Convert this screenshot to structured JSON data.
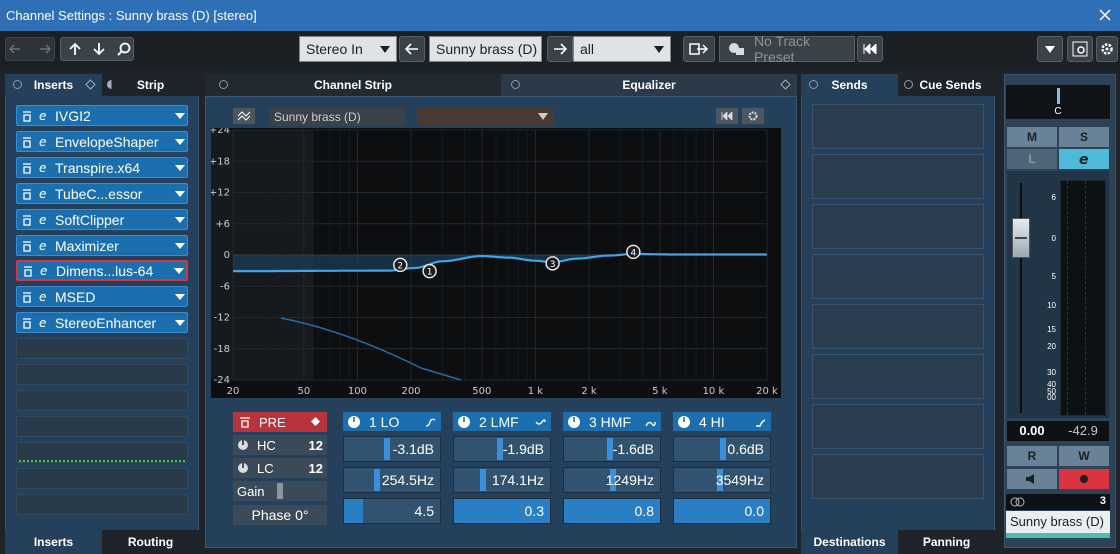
{
  "window": {
    "title": "Channel Settings : Sunny brass (D) [stereo]"
  },
  "toolbar": {
    "input": "Stereo In",
    "track": "Sunny brass (D)",
    "filter": "all",
    "preset_placeholder": "No Track Preset"
  },
  "left": {
    "tab_inserts": "Inserts",
    "tab_strip": "Strip",
    "bottom_inserts": "Inserts",
    "bottom_routing": "Routing",
    "plugins": [
      "IVGI2",
      "EnvelopeShaper",
      "Transpire.x64",
      "TubeC...essor",
      "SoftClipper",
      "Maximizer",
      "Dimens...lus-64",
      "MSED",
      "StereoEnhancer"
    ]
  },
  "center": {
    "tab_channelstrip": "Channel Strip",
    "tab_equalizer": "Equalizer",
    "preset": "Sunny brass (D)",
    "ylabels": [
      "+24",
      "+18",
      "+12",
      "+6",
      "0",
      "-6",
      "-12",
      "-18",
      "-24"
    ],
    "xlabels": [
      "20",
      "50",
      "100",
      "200",
      "500",
      "1 k",
      "2 k",
      "5 k",
      "10 k",
      "20 k"
    ],
    "pre": "PRE",
    "hc": "HC",
    "hc_val": "12",
    "lc": "LC",
    "lc_val": "12",
    "gain": "Gain",
    "phase": "Phase 0°",
    "bands": [
      {
        "name": "1 LO",
        "gain": "-3.1dB",
        "freq": "254.5Hz",
        "q": "4.5",
        "gain_level": 0.44,
        "freq_level": 0.34,
        "q_level": 0.2
      },
      {
        "name": "2 LMF",
        "gain": "-1.9dB",
        "freq": "174.1Hz",
        "q": "0.3",
        "gain_level": 0.47,
        "freq_level": 0.3,
        "q_level": 1.0
      },
      {
        "name": "3 HMF",
        "gain": "-1.6dB",
        "freq": "1249Hz",
        "q": "0.8",
        "gain_level": 0.47,
        "freq_level": 0.5,
        "q_level": 1.0
      },
      {
        "name": "4 HI",
        "gain": "0.6dB",
        "freq": "3549Hz",
        "q": "0.0",
        "gain_level": 0.5,
        "freq_level": 0.47,
        "q_level": 1.0
      }
    ],
    "nodes": [
      "2",
      "1",
      "3",
      "4"
    ]
  },
  "right": {
    "tab_sends": "Sends",
    "tab_cuesends": "Cue Sends",
    "bottom_destinations": "Destinations",
    "bottom_panning": "Panning"
  },
  "mixer": {
    "pan": "C",
    "m": "M",
    "s": "S",
    "l": "L",
    "r": "R",
    "w": "W",
    "scale": [
      "6",
      "0",
      "5",
      "10",
      "15",
      "20",
      "30",
      "40",
      "50",
      "00"
    ],
    "volume": "0.00",
    "peak": "-42.9",
    "channel_number": "3",
    "channel_name": "Sunny brass (D)"
  }
}
